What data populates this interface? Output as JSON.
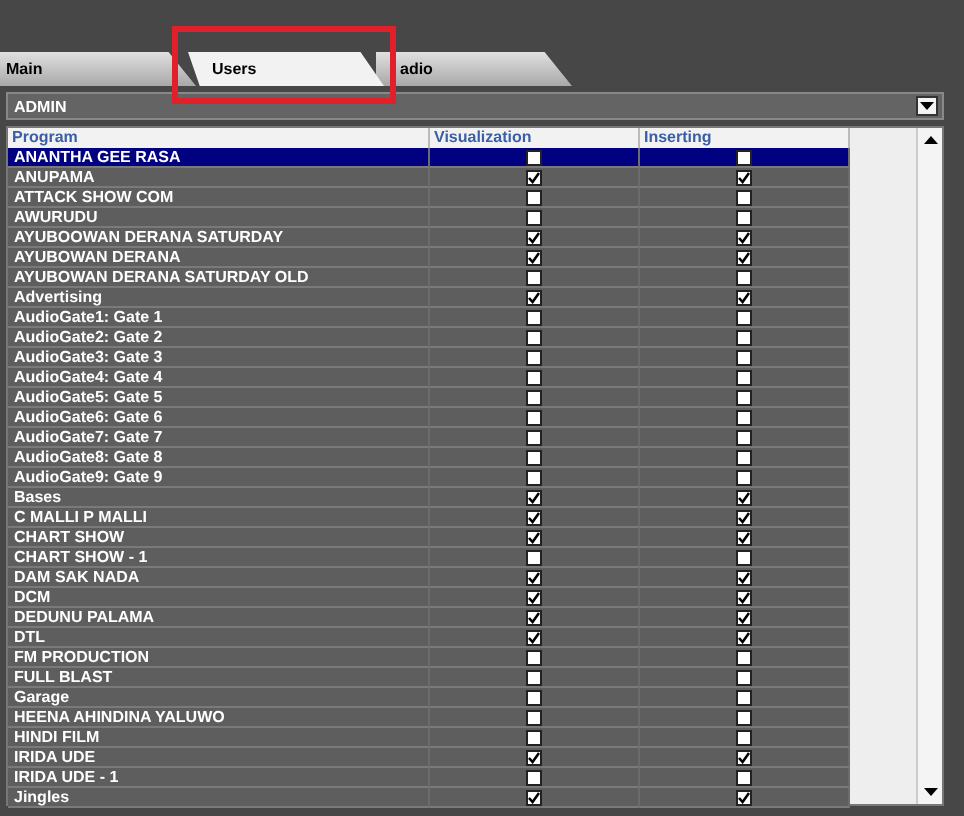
{
  "tabs": [
    {
      "label": "Main",
      "selected": false
    },
    {
      "label": "Users",
      "selected": true
    },
    {
      "label": "adio",
      "selected": false
    }
  ],
  "user_select": {
    "value": "ADMIN"
  },
  "table": {
    "columns": [
      "Program",
      "Visualization",
      "Inserting"
    ],
    "rows": [
      {
        "program": "ANANTHA GEE RASA",
        "visualization": false,
        "inserting": false,
        "selected": true
      },
      {
        "program": "ANUPAMA",
        "visualization": true,
        "inserting": true,
        "selected": false
      },
      {
        "program": "ATTACK SHOW COM",
        "visualization": false,
        "inserting": false,
        "selected": false
      },
      {
        "program": "AWURUDU",
        "visualization": false,
        "inserting": false,
        "selected": false
      },
      {
        "program": "AYUBOOWAN DERANA SATURDAY",
        "visualization": true,
        "inserting": true,
        "selected": false
      },
      {
        "program": "AYUBOWAN DERANA",
        "visualization": true,
        "inserting": true,
        "selected": false
      },
      {
        "program": "AYUBOWAN DERANA SATURDAY OLD",
        "visualization": false,
        "inserting": false,
        "selected": false
      },
      {
        "program": "Advertising",
        "visualization": true,
        "inserting": true,
        "selected": false
      },
      {
        "program": "AudioGate1: Gate 1",
        "visualization": false,
        "inserting": false,
        "selected": false
      },
      {
        "program": "AudioGate2: Gate 2",
        "visualization": false,
        "inserting": false,
        "selected": false
      },
      {
        "program": "AudioGate3: Gate 3",
        "visualization": false,
        "inserting": false,
        "selected": false
      },
      {
        "program": "AudioGate4: Gate 4",
        "visualization": false,
        "inserting": false,
        "selected": false
      },
      {
        "program": "AudioGate5: Gate 5",
        "visualization": false,
        "inserting": false,
        "selected": false
      },
      {
        "program": "AudioGate6: Gate 6",
        "visualization": false,
        "inserting": false,
        "selected": false
      },
      {
        "program": "AudioGate7: Gate 7",
        "visualization": false,
        "inserting": false,
        "selected": false
      },
      {
        "program": "AudioGate8: Gate 8",
        "visualization": false,
        "inserting": false,
        "selected": false
      },
      {
        "program": "AudioGate9: Gate 9",
        "visualization": false,
        "inserting": false,
        "selected": false
      },
      {
        "program": "Bases",
        "visualization": true,
        "inserting": true,
        "selected": false
      },
      {
        "program": "C MALLI P MALLI",
        "visualization": true,
        "inserting": true,
        "selected": false
      },
      {
        "program": "CHART SHOW",
        "visualization": true,
        "inserting": true,
        "selected": false
      },
      {
        "program": "CHART SHOW - 1",
        "visualization": false,
        "inserting": false,
        "selected": false
      },
      {
        "program": "DAM SAK NADA",
        "visualization": true,
        "inserting": true,
        "selected": false
      },
      {
        "program": "DCM",
        "visualization": true,
        "inserting": true,
        "selected": false
      },
      {
        "program": "DEDUNU PALAMA",
        "visualization": true,
        "inserting": true,
        "selected": false
      },
      {
        "program": "DTL",
        "visualization": true,
        "inserting": true,
        "selected": false
      },
      {
        "program": "FM PRODUCTION",
        "visualization": false,
        "inserting": false,
        "selected": false
      },
      {
        "program": "FULL BLAST",
        "visualization": false,
        "inserting": false,
        "selected": false
      },
      {
        "program": "Garage",
        "visualization": false,
        "inserting": false,
        "selected": false
      },
      {
        "program": "HEENA AHINDINA YALUWO",
        "visualization": false,
        "inserting": false,
        "selected": false
      },
      {
        "program": "HINDI FILM",
        "visualization": false,
        "inserting": false,
        "selected": false
      },
      {
        "program": "IRIDA UDE",
        "visualization": true,
        "inserting": true,
        "selected": false
      },
      {
        "program": "IRIDA UDE - 1",
        "visualization": false,
        "inserting": false,
        "selected": false
      },
      {
        "program": "Jingles",
        "visualization": true,
        "inserting": true,
        "selected": false
      }
    ]
  }
}
